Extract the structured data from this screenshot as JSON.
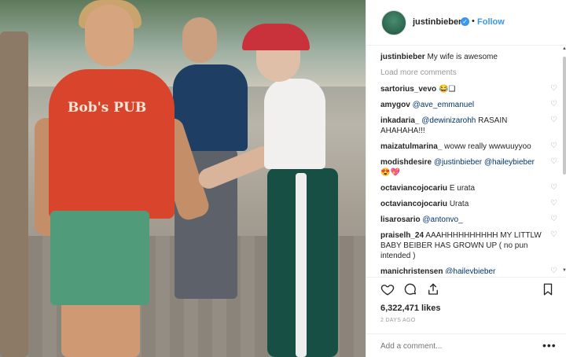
{
  "photo": {
    "shirt_text": "Bob's PUB"
  },
  "header": {
    "username": "justinbieber",
    "verified_icon": "verified-badge-icon",
    "dot": "•",
    "follow_label": "Follow"
  },
  "caption": {
    "user": "justinbieber",
    "text": "My wife is awesome"
  },
  "load_more": "Load more comments",
  "comments": [
    {
      "user": "sartorius_vevo",
      "text": "😂❑",
      "mention": ""
    },
    {
      "user": "amygov",
      "text": "",
      "mention": "@ave_emmanuel"
    },
    {
      "user": "inkadaria_",
      "text": " RASAIN AHAHAHA!!!",
      "mention": "@dewinizarohh"
    },
    {
      "user": "maizatulmarina_",
      "text": "woww really wwwuuyyoo",
      "mention": ""
    },
    {
      "user": "modishdesire",
      "text": " 😍💖",
      "mention": "@justinbieber @haileybieber"
    },
    {
      "user": "octaviancojocariu",
      "text": "E urata",
      "mention": ""
    },
    {
      "user": "octaviancojocariu",
      "text": "Urata",
      "mention": ""
    },
    {
      "user": "lisarosario",
      "text": "",
      "mention": "@antonvo_"
    },
    {
      "user": "praiselh_24",
      "text": "AAAHHHHHHHHHH MY LITTLW BABY BEIBER HAS GROWN UP ( no pun intended )",
      "mention": ""
    },
    {
      "user": "manichristensen",
      "text": "",
      "mention": "@haileybieber"
    }
  ],
  "likes": "6,322,471 likes",
  "date": "2 DAYS AGO",
  "add_comment_placeholder": "Add a comment...",
  "more_label": "•••",
  "colors": {
    "accent": "#3897f0",
    "text": "#262626",
    "muted": "#999999"
  }
}
